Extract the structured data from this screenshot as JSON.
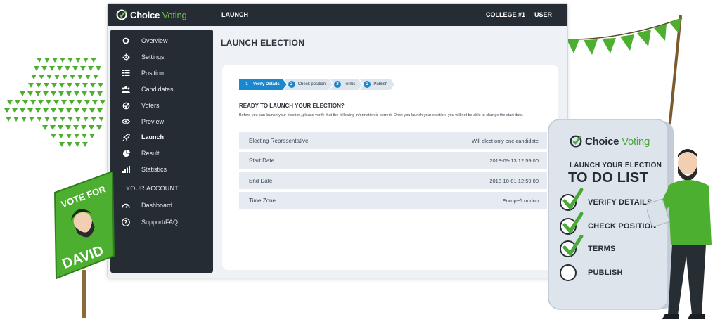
{
  "brand": {
    "name_part1": "Choice",
    "name_part2": "Voting"
  },
  "topbar": {
    "section": "LAUNCH",
    "college": "COLLEGE #1",
    "user": "USER"
  },
  "sidebar": {
    "items": [
      {
        "label": "Overview",
        "icon": "circle-icon"
      },
      {
        "label": "Settings",
        "icon": "gear-icon"
      },
      {
        "label": "Position",
        "icon": "list-icon"
      },
      {
        "label": "Candidates",
        "icon": "people-icon"
      },
      {
        "label": "Voters",
        "icon": "check-logo-icon"
      },
      {
        "label": "Preview",
        "icon": "eye-icon"
      },
      {
        "label": "Launch",
        "icon": "rocket-icon"
      },
      {
        "label": "Result",
        "icon": "pie-chart-icon"
      },
      {
        "label": "Statistics",
        "icon": "bar-chart-icon"
      }
    ],
    "account_label": "YOUR ACCOUNT",
    "account_items": [
      {
        "label": "Dashboard",
        "icon": "gauge-icon"
      },
      {
        "label": "Support/FAQ",
        "icon": "help-icon"
      }
    ]
  },
  "main": {
    "title": "LAUNCH ELECTION",
    "steps": [
      {
        "num": "1",
        "label": "Verify Details"
      },
      {
        "num": "2",
        "label": "Check position"
      },
      {
        "num": "3",
        "label": "Terms"
      },
      {
        "num": "2",
        "label": "Publish"
      }
    ],
    "ready_title": "READY TO LAUNCH YOUR ELECTION?",
    "ready_desc": "Before you can launch your election, please verify that the following information is correct. Once you launch your election, you will not be able to change the start date.",
    "rows": [
      {
        "key": "Electing Representative",
        "value": "Will elect only one candidate"
      },
      {
        "key": "Start Date",
        "value": "2018-09-13 12:59:00"
      },
      {
        "key": "End Date",
        "value": "2018-10-01 12:59:00"
      },
      {
        "key": "Time Zone",
        "value": "Europe/London"
      }
    ]
  },
  "sign": {
    "line1": "VOTE FOR",
    "line2": "DAVID"
  },
  "clipboard": {
    "subtitle": "LAUNCH YOUR ELECTION",
    "title": "TO DO LIST",
    "todos": [
      {
        "label": "VERIFY DETAILS",
        "done": true
      },
      {
        "label": "CHECK POSITION",
        "done": true
      },
      {
        "label": "TERMS",
        "done": true
      },
      {
        "label": "PUBLISH",
        "done": false
      }
    ]
  },
  "colors": {
    "accent": "#6cc04a",
    "dark": "#252c33",
    "step_blue": "#1a88d0",
    "panel_bg": "#eef1f5"
  }
}
